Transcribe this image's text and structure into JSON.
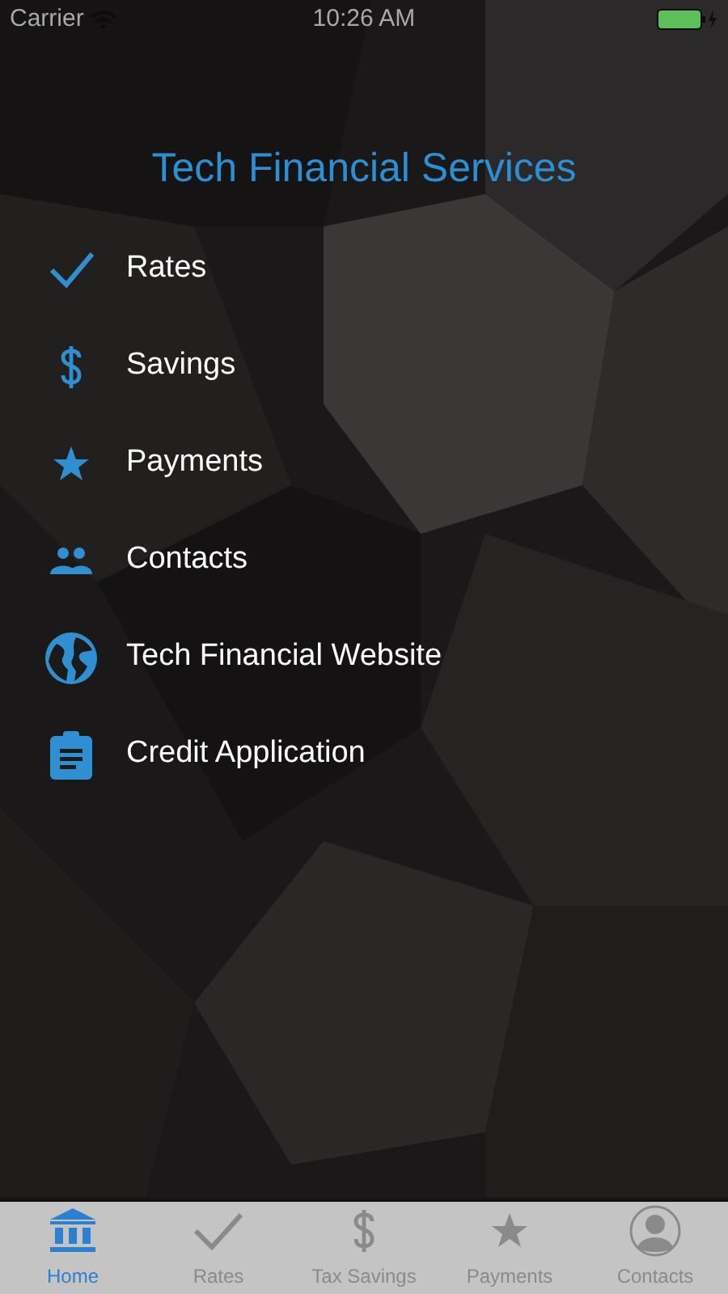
{
  "status_bar": {
    "carrier": "Carrier",
    "time": "10:26 AM"
  },
  "title": "Tech Financial Services",
  "menu": [
    {
      "label": "Rates"
    },
    {
      "label": "Savings"
    },
    {
      "label": "Payments"
    },
    {
      "label": "Contacts"
    },
    {
      "label": "Tech Financial Website"
    },
    {
      "label": "Credit Application"
    }
  ],
  "tab_bar": [
    {
      "label": "Home",
      "selected": true
    },
    {
      "label": "Rates",
      "selected": false
    },
    {
      "label": "Tax Savings",
      "selected": false
    },
    {
      "label": "Payments",
      "selected": false
    },
    {
      "label": "Contacts",
      "selected": false
    }
  ]
}
